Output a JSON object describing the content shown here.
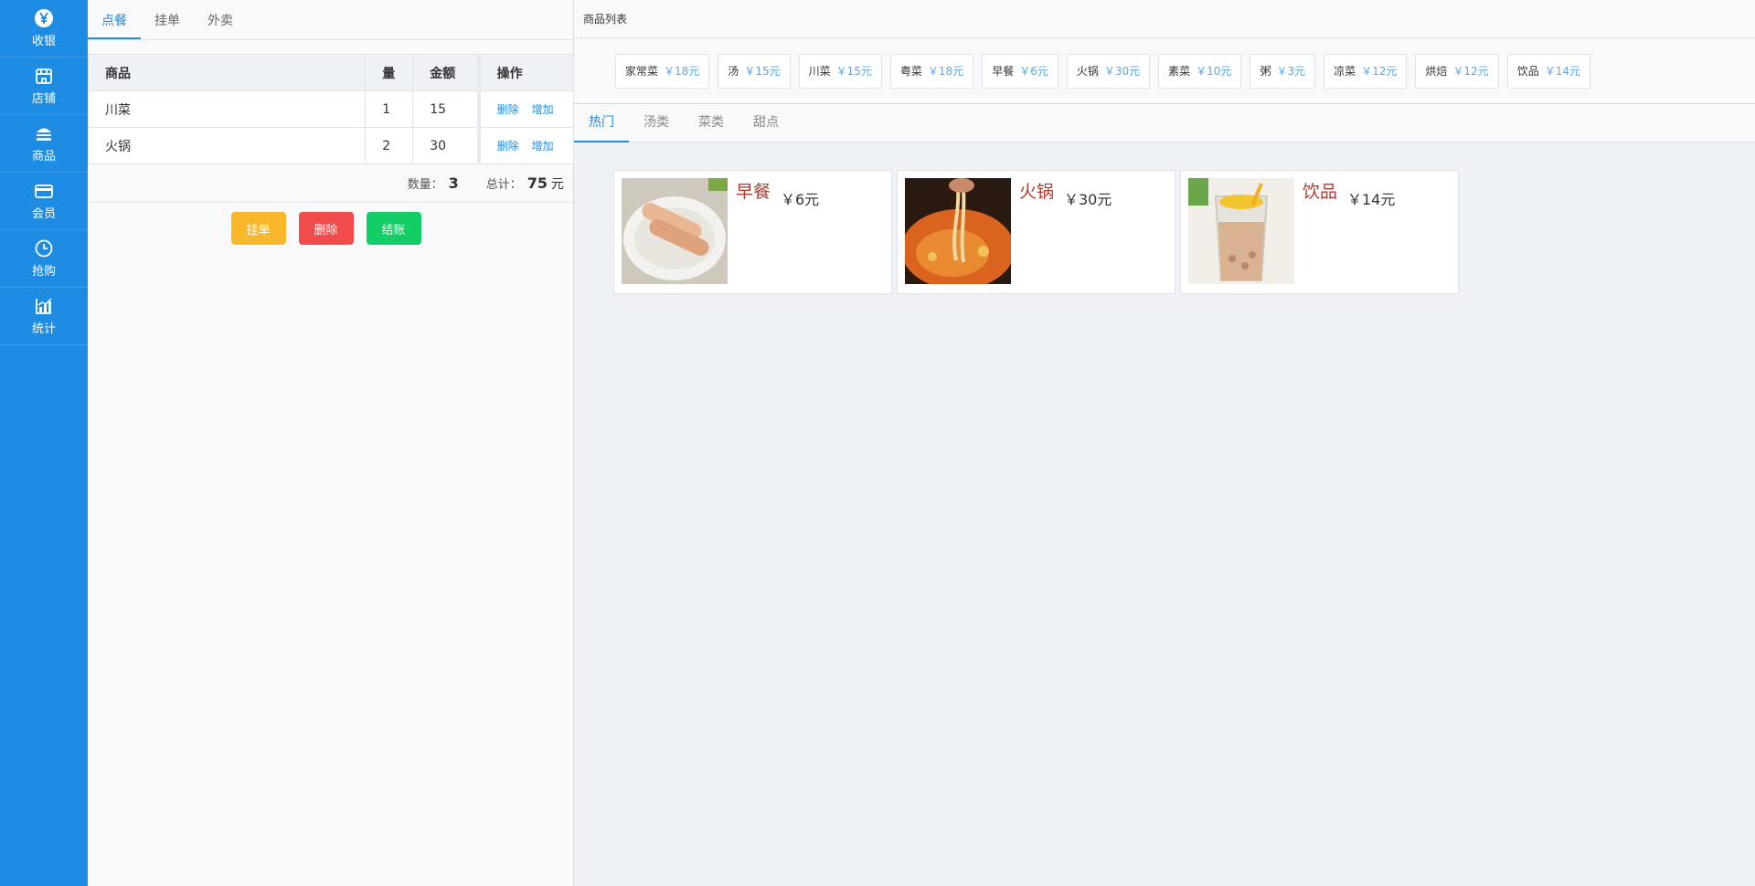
{
  "sidebar": {
    "items": [
      {
        "label": "收银",
        "icon": "yen-icon"
      },
      {
        "label": "店铺",
        "icon": "shop-icon"
      },
      {
        "label": "商品",
        "icon": "burger-icon"
      },
      {
        "label": "会员",
        "icon": "card-icon"
      },
      {
        "label": "抢购",
        "icon": "clock-icon"
      },
      {
        "label": "统计",
        "icon": "chart-icon"
      }
    ]
  },
  "order": {
    "tabs": [
      "点餐",
      "挂单",
      "外卖"
    ],
    "columns": [
      "商品",
      "量",
      "金额",
      "操作"
    ],
    "rows": [
      {
        "name": "川菜",
        "qty": "1",
        "amount": "15"
      },
      {
        "name": "火锅",
        "qty": "2",
        "amount": "30"
      }
    ],
    "delete_label": "删除",
    "add_label": "增加",
    "count_label": "数量：",
    "count_value": "3",
    "total_label": "总计：",
    "total_value": "75",
    "total_unit": "元",
    "buttons": {
      "hold": "挂单",
      "delete": "删除",
      "checkout": "结账"
    },
    "colors": {
      "hold": "#f8b82a",
      "delete": "#f24b4b",
      "checkout": "#13ce66"
    }
  },
  "products": {
    "title": "商品列表",
    "quick": [
      {
        "name": "家常菜",
        "price": "￥18元"
      },
      {
        "name": "汤",
        "price": "￥15元"
      },
      {
        "name": "川菜",
        "price": "￥15元"
      },
      {
        "name": "粤菜",
        "price": "￥18元"
      },
      {
        "name": "早餐",
        "price": "￥6元"
      },
      {
        "name": "火锅",
        "price": "￥30元"
      },
      {
        "name": "素菜",
        "price": "￥10元"
      },
      {
        "name": "粥",
        "price": "￥3元"
      },
      {
        "name": "凉菜",
        "price": "￥12元"
      },
      {
        "name": "烘焙",
        "price": "￥12元"
      },
      {
        "name": "饮品",
        "price": "￥14元"
      }
    ],
    "tabs": [
      "热门",
      "汤类",
      "菜类",
      "甜点"
    ],
    "cards": [
      {
        "name": "早餐",
        "price": "￥6元"
      },
      {
        "name": "火锅",
        "price": "￥30元"
      },
      {
        "name": "饮品",
        "price": "￥14元"
      }
    ]
  },
  "theme": {
    "accent": "#1f8ce3",
    "sidebar_bg": "#1f8ce3"
  }
}
